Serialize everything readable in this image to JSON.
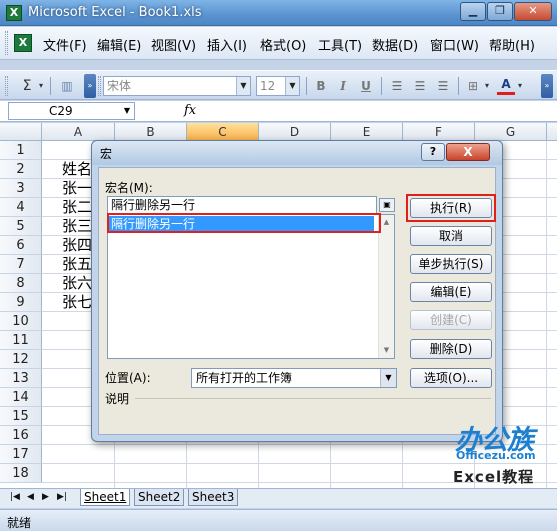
{
  "window": {
    "title": "Microsoft Excel - Book1.xls"
  },
  "menu": [
    "文件(F)",
    "编辑(E)",
    "视图(V)",
    "插入(I)",
    "格式(O)",
    "工具(T)",
    "数据(D)",
    "窗口(W)",
    "帮助(H)"
  ],
  "toolbar": {
    "sigma": "Σ",
    "font_name": "宋体",
    "font_size": "12",
    "bold": "B",
    "italic": "I",
    "underline": "U",
    "font_color": "A"
  },
  "formula_bar": {
    "cell_ref": "C29",
    "fx": "fx"
  },
  "grid": {
    "columns": [
      "A",
      "B",
      "C",
      "D",
      "E",
      "F",
      "G"
    ],
    "selected_column": "C",
    "rows": [
      "1",
      "2",
      "3",
      "4",
      "5",
      "6",
      "7",
      "8",
      "9",
      "10",
      "11",
      "12",
      "13",
      "14",
      "15",
      "16",
      "17",
      "18"
    ],
    "cells_col_a": [
      "",
      "姓名",
      "张一",
      "张二",
      "张三",
      "张四",
      "张五",
      "张六",
      "张七"
    ]
  },
  "sheets": [
    "Sheet1",
    "Sheet2",
    "Sheet3"
  ],
  "status": "就绪",
  "dialog": {
    "title": "宏",
    "help": "?",
    "close": "X",
    "macro_name_label": "宏名(M):",
    "macro_name_value": "隔行删除另一行",
    "macro_list": [
      "隔行删除另一行"
    ],
    "buttons": {
      "run": "执行(R)",
      "cancel": "取消",
      "step": "单步执行(S)",
      "edit": "编辑(E)",
      "create": "创建(C)",
      "delete": "删除(D)",
      "options": "选项(O)..."
    },
    "location_label": "位置(A):",
    "location_value": "所有打开的工作簿",
    "description_label": "说明"
  },
  "watermark": {
    "line1": "办公族",
    "line2": "Officezu.com",
    "line3": "Excel教程"
  }
}
